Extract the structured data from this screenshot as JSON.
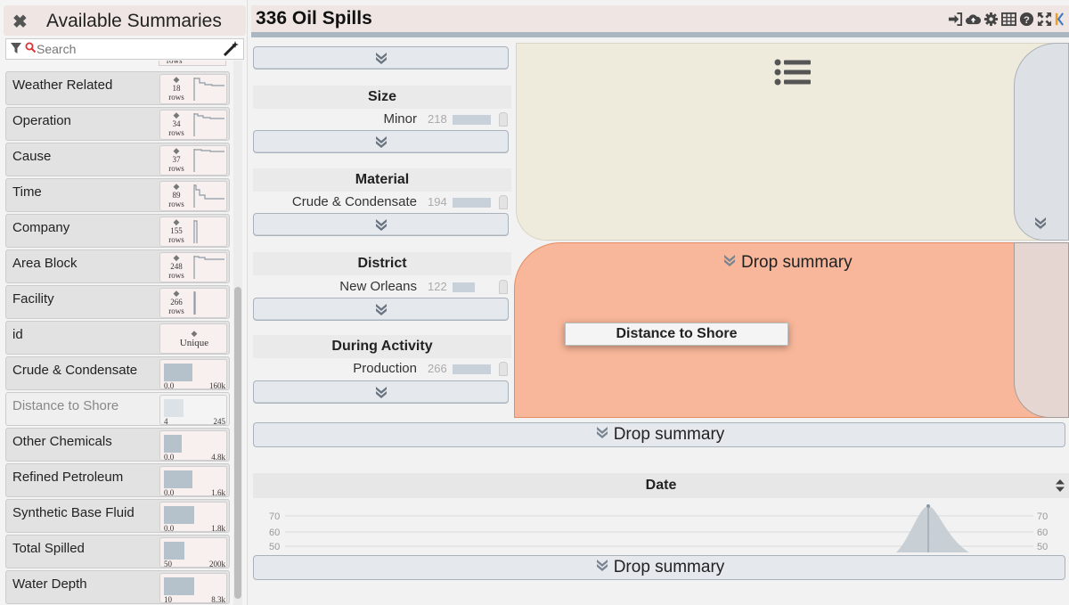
{
  "sidebar": {
    "title": "Available Summaries",
    "close_icon": "close-icon",
    "search": {
      "placeholder": "Search",
      "value": ""
    },
    "partial_top_label": "rows",
    "items": [
      {
        "label": "Weather Related",
        "type": "categorical",
        "count": "18",
        "unit": "rows"
      },
      {
        "label": "Operation",
        "type": "categorical",
        "count": "34",
        "unit": "rows"
      },
      {
        "label": "Cause",
        "type": "categorical",
        "count": "37",
        "unit": "rows"
      },
      {
        "label": "Time",
        "type": "categorical",
        "count": "89",
        "unit": "rows"
      },
      {
        "label": "Company",
        "type": "categorical",
        "count": "155",
        "unit": "rows"
      },
      {
        "label": "Area Block",
        "type": "categorical",
        "count": "248",
        "unit": "rows"
      },
      {
        "label": "Facility",
        "type": "categorical",
        "count": "266",
        "unit": "rows"
      },
      {
        "label": "id",
        "type": "unique",
        "badge": "Unique"
      },
      {
        "label": "Crude & Condensate",
        "type": "numeric",
        "min": "0.0",
        "max": "160k",
        "fill": 0.45
      },
      {
        "label": "Distance to Shore",
        "type": "numeric",
        "min": "4",
        "max": "245",
        "fill": 0.3,
        "faded": true
      },
      {
        "label": "Other Chemicals",
        "type": "numeric",
        "min": "0.0",
        "max": "4.8k",
        "fill": 0.28
      },
      {
        "label": "Refined Petroleum",
        "type": "numeric",
        "min": "0.0",
        "max": "1.6k",
        "fill": 0.45
      },
      {
        "label": "Synthetic Base Fluid",
        "type": "numeric",
        "min": "0.0",
        "max": "1.8k",
        "fill": 0.47
      },
      {
        "label": "Total Spilled",
        "type": "numeric",
        "min": "50",
        "max": "200k",
        "fill": 0.32
      },
      {
        "label": "Water Depth",
        "type": "numeric",
        "min": "10",
        "max": "8.3k",
        "fill": 0.47
      }
    ]
  },
  "header": {
    "count": "336",
    "title": "Oil Spills",
    "toolbar_icons": [
      "sign-in-icon",
      "cloud-upload-icon",
      "gear-icon",
      "table-icon",
      "help-icon",
      "fullscreen-icon",
      "logo-icon"
    ]
  },
  "categories": [
    {
      "name": "Size",
      "top_item": "Minor",
      "value": "218"
    },
    {
      "name": "Material",
      "top_item": "Crude & Condensate",
      "value": "194"
    },
    {
      "name": "District",
      "top_item": "New Orleans",
      "value": "122"
    },
    {
      "name": "During Activity",
      "top_item": "Production",
      "value": "266"
    }
  ],
  "panels": {
    "list_icon": "list-icon",
    "drop_summary": "Drop summary",
    "dragging": "Distance to Shore"
  },
  "bottom": {
    "drop_summary_1": "Drop summary",
    "drop_summary_2": "Drop summary",
    "date_title": "Date",
    "y_ticks": [
      "70",
      "60",
      "50"
    ]
  },
  "colors": {
    "accent_orange": "#f8b79a",
    "list_panel": "#efebdc",
    "bar_blue": "#b5c2cc",
    "logo_orange": "#f29b29"
  }
}
